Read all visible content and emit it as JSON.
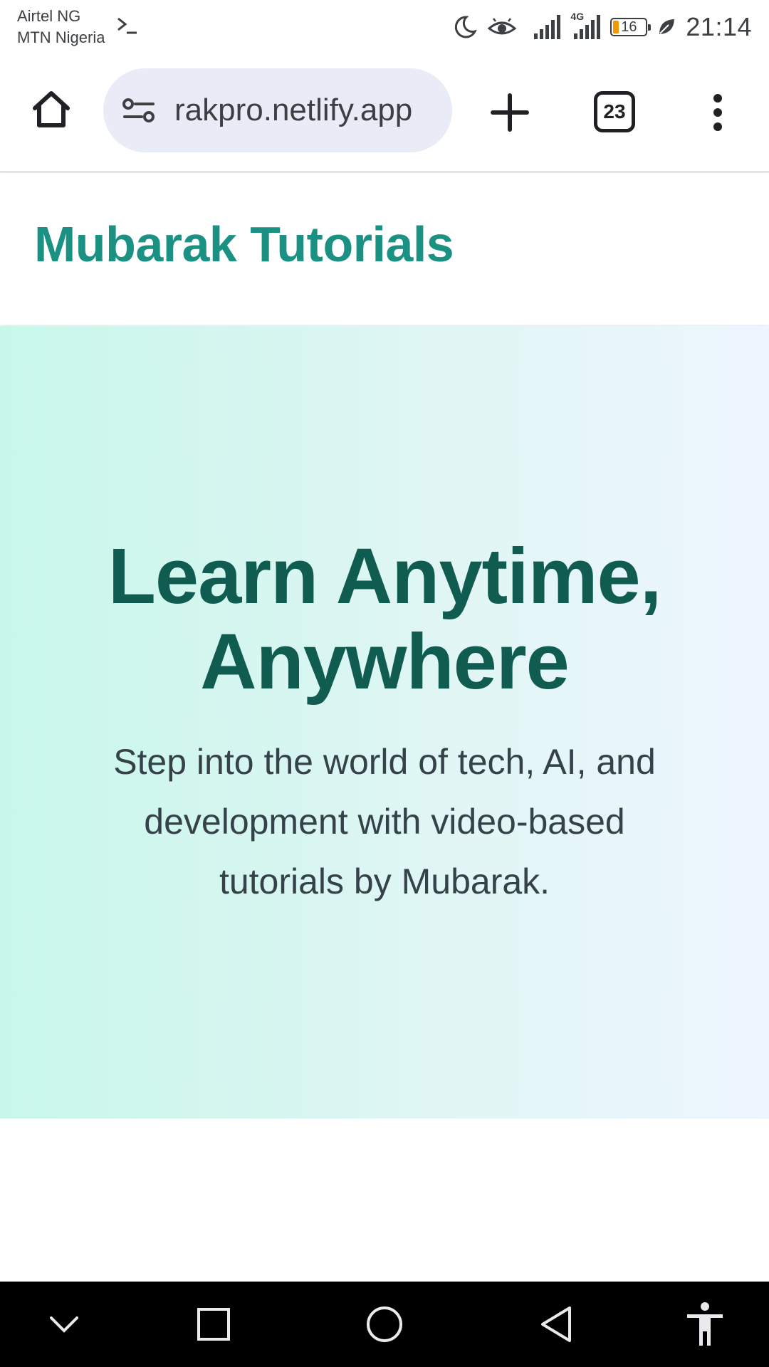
{
  "status_bar": {
    "carrier_1": "Airtel NG",
    "carrier_2": "MTN Nigeria",
    "network_type": "4G",
    "battery_level": "16",
    "time": "21:14",
    "icons": [
      "terminal-icon",
      "moon-icon",
      "eye-icon",
      "signal-icon",
      "signal-4g-icon",
      "battery-icon",
      "leaf-icon"
    ]
  },
  "browser": {
    "url": "rakpro.netlify.app",
    "tab_count": "23",
    "icons": [
      "home-icon",
      "site-settings-icon",
      "plus-icon",
      "tabs-icon",
      "more-vert-icon"
    ]
  },
  "site": {
    "title": "Mubarak Tutorials"
  },
  "hero": {
    "title_line1": "Learn Anytime,",
    "title_line2": "Anywhere",
    "subtitle": "Step into the world of tech, AI, and development with video-based tutorials by Mubarak."
  },
  "nav_bar": {
    "icons": [
      "chevron-down-icon",
      "recents-square-icon",
      "home-circle-icon",
      "back-triangle-icon",
      "accessibility-icon"
    ]
  },
  "colors": {
    "brand_teal": "#1a9183",
    "hero_title": "#105c51",
    "hero_gradient_start": "#c8f7ea",
    "hero_gradient_end": "#edf5fe",
    "omnibox_bg": "#e9ecf6"
  }
}
